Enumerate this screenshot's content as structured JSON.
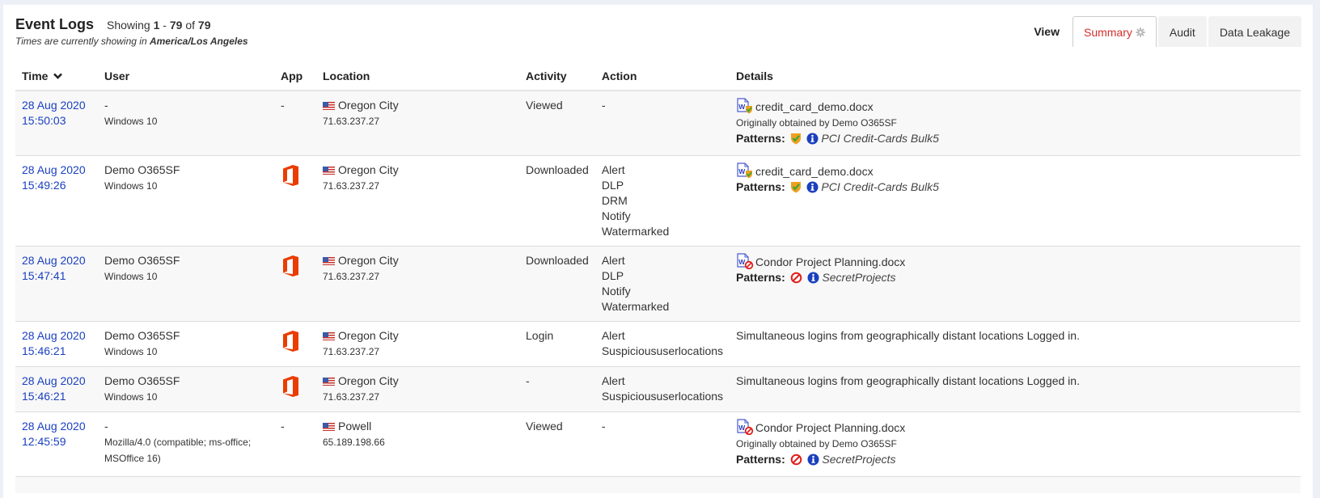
{
  "header": {
    "title": "Event Logs",
    "showing_prefix": "Showing",
    "range_start": "1",
    "range_sep": " - ",
    "range_end": "79",
    "of_label": " of ",
    "total": "79",
    "timezone_prefix": "Times are currently showing in ",
    "timezone": "America/Los Angeles"
  },
  "view": {
    "label": "View",
    "tabs": [
      {
        "label": "Summary",
        "active": true,
        "icon": "gear-icon"
      },
      {
        "label": "Audit",
        "active": false
      },
      {
        "label": "Data Leakage",
        "active": false
      }
    ]
  },
  "colors": {
    "link": "#1a3fbf",
    "active_tab": "#d32f2f",
    "office_orange": "#eb3c00",
    "block_red": "#e0201b",
    "info_blue": "#1a3fbf",
    "shield_orange": "#f0a020",
    "shield_green": "#3aa635"
  },
  "table": {
    "columns": [
      "Time",
      "User",
      "App",
      "Location",
      "Activity",
      "Action",
      "Details"
    ],
    "sort_column": "Time",
    "sort_icon": "chevron-down-icon",
    "rows": [
      {
        "date": "28 Aug 2020",
        "time": "15:50:03",
        "user": "-",
        "device": "Windows 10",
        "app": "-",
        "location": "Oregon City",
        "ip": "71.63.237.27",
        "activity": "Viewed",
        "actions": [
          "-"
        ],
        "details": {
          "file": "credit_card_demo.docx",
          "file_status": "protected",
          "obtained": "Originally obtained by Demo O365SF",
          "patterns_label": "Patterns:",
          "pattern_status": "protected",
          "pattern": "PCI Credit-Cards Bulk5"
        }
      },
      {
        "date": "28 Aug 2020",
        "time": "15:49:26",
        "user": "Demo O365SF",
        "device": "Windows 10",
        "app": "office",
        "location": "Oregon City",
        "ip": "71.63.237.27",
        "activity": "Downloaded",
        "actions": [
          "Alert",
          "DLP",
          "DRM",
          "Notify",
          "Watermarked"
        ],
        "details": {
          "file": "credit_card_demo.docx",
          "file_status": "protected",
          "patterns_label": "Patterns:",
          "pattern_status": "protected",
          "pattern": "PCI Credit-Cards Bulk5"
        }
      },
      {
        "date": "28 Aug 2020",
        "time": "15:47:41",
        "user": "Demo O365SF",
        "device": "Windows 10",
        "app": "office",
        "location": "Oregon City",
        "ip": "71.63.237.27",
        "activity": "Downloaded",
        "actions": [
          "Alert",
          "DLP",
          "Notify",
          "Watermarked"
        ],
        "details": {
          "file": "Condor Project Planning.docx",
          "file_status": "blocked",
          "patterns_label": "Patterns:",
          "pattern_status": "blocked",
          "pattern": "SecretProjects"
        }
      },
      {
        "date": "28 Aug 2020",
        "time": "15:46:21",
        "user": "Demo O365SF",
        "device": "Windows 10",
        "app": "office",
        "location": "Oregon City",
        "ip": "71.63.237.27",
        "activity": "Login",
        "actions": [
          "Alert",
          "Suspicioususerlocations"
        ],
        "details": {
          "text": "Simultaneous logins from geographically distant locations Logged in."
        }
      },
      {
        "date": "28 Aug 2020",
        "time": "15:46:21",
        "user": "Demo O365SF",
        "device": "Windows 10",
        "app": "office",
        "location": "Oregon City",
        "ip": "71.63.237.27",
        "activity": "-",
        "actions": [
          "Alert",
          "Suspicioususerlocations"
        ],
        "details": {
          "text": "Simultaneous logins from geographically distant locations Logged in."
        }
      },
      {
        "date": "28 Aug 2020",
        "time": "12:45:59",
        "user": "-",
        "device": "Mozilla/4.0 (compatible; ms-office; MSOffice 16)",
        "app": "-",
        "location": "Powell",
        "ip": "65.189.198.66",
        "activity": "Viewed",
        "actions": [
          "-"
        ],
        "details": {
          "file": "Condor Project Planning.docx",
          "file_status": "blocked",
          "obtained": "Originally obtained by Demo O365SF",
          "patterns_label": "Patterns:",
          "pattern_status": "blocked",
          "pattern": "SecretProjects"
        }
      }
    ]
  }
}
